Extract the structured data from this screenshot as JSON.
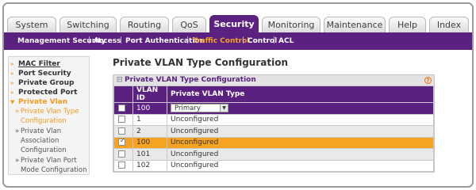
{
  "top_tabs": [
    {
      "label": "System",
      "active": false
    },
    {
      "label": "Switching",
      "active": false
    },
    {
      "label": "Routing",
      "active": false
    },
    {
      "label": "QoS",
      "active": false
    },
    {
      "label": "Security",
      "active": true
    },
    {
      "label": "Monitoring",
      "active": false
    },
    {
      "label": "Maintenance",
      "active": false
    },
    {
      "label": "Help",
      "active": false
    },
    {
      "label": "Index",
      "active": false
    }
  ],
  "sub_nav": [
    {
      "label": "Management Security",
      "active": false
    },
    {
      "label": "Access",
      "active": false
    },
    {
      "label": "Port Authentication",
      "active": false
    },
    {
      "label": "Traffic Control",
      "active": true
    },
    {
      "label": "Control",
      "active": false
    },
    {
      "label": "ACL",
      "active": false
    }
  ],
  "sidebar": {
    "items": [
      {
        "label": "MAC Filter"
      },
      {
        "label": "Port Security"
      },
      {
        "label": "Private Group"
      },
      {
        "label": "Protected Port"
      },
      {
        "label": "Private Vlan"
      },
      {
        "label_1": "Private Vlan Type",
        "label_2": "Configuration"
      },
      {
        "label_1": "Private Vlan",
        "label_2": "Association",
        "label_3": "Configuration"
      },
      {
        "label_1": "Private Vlan Port",
        "label_2": "Mode Configuration"
      }
    ]
  },
  "page_title": "Private VLAN Type Configuration",
  "panel": {
    "title": "Private VLAN Type Configuration",
    "collapse_symbol": "⊟",
    "help_symbol": "?",
    "columns": [
      "VLAN ID",
      "Private VLAN Type"
    ],
    "edit_row": {
      "vlan_id": "100",
      "type_selected": "Primary"
    },
    "rows": [
      {
        "vlan_id": "1",
        "type": "Unconfigured",
        "checked": false
      },
      {
        "vlan_id": "2",
        "type": "Unconfigured",
        "checked": false
      },
      {
        "vlan_id": "100",
        "type": "Unconfigured",
        "checked": true
      },
      {
        "vlan_id": "101",
        "type": "Unconfigured",
        "checked": false
      },
      {
        "vlan_id": "102",
        "type": "Unconfigured",
        "checked": false
      }
    ]
  },
  "colors": {
    "brand_purple": "#5a2181",
    "accent_orange": "#f6a323",
    "sidebar_orange": "#f39a20"
  }
}
